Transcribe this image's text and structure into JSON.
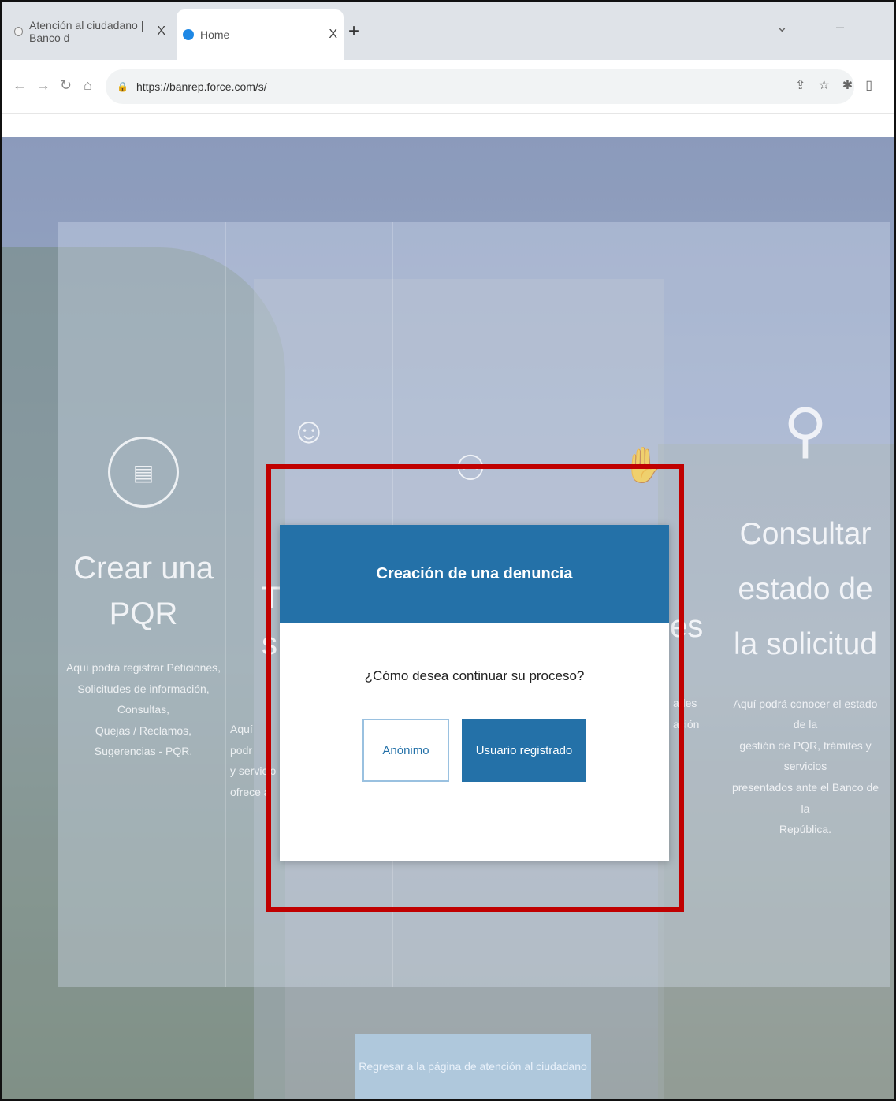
{
  "browser": {
    "tabs": [
      {
        "label": "Atención al ciudadano | Banco d"
      },
      {
        "label": "Home"
      }
    ],
    "new_tab": "+",
    "close": "X",
    "url": "https://banrep.force.com/s/",
    "window_controls": "⌄ –"
  },
  "page": {
    "cards": [
      {
        "title": "Crear una PQR",
        "desc_lines": [
          "Aquí podrá registrar Peticiones,",
          "Solicitudes de información, Consultas,",
          "Quejas / Reclamos, Sugerencias - PQR."
        ]
      },
      {
        "title_fragment_1": "T",
        "title_fragment_2": "s",
        "desc_fragments": [
          "Aquí podr",
          "y servicio",
          "ofrece a"
        ]
      },
      {
        "title_fragment": "es",
        "desc_fragments": [
          "ades",
          "ación"
        ]
      },
      {
        "title": "Consultar estado de la solicitud",
        "desc_lines": [
          "Aquí podrá conocer el estado de la",
          "gestión de PQR, trámites y servicios",
          "presentados ante el Banco de la",
          "República."
        ]
      }
    ],
    "back_button": "Regresar a la página de atención al ciudadano"
  },
  "modal": {
    "title": "Creación de una denuncia",
    "question": "¿Cómo desea continuar su proceso?",
    "btn_anonymous": "Anónimo",
    "btn_registered": "Usuario registrado"
  },
  "colors": {
    "modal_header": "#2471a8",
    "highlight": "#c00000"
  }
}
